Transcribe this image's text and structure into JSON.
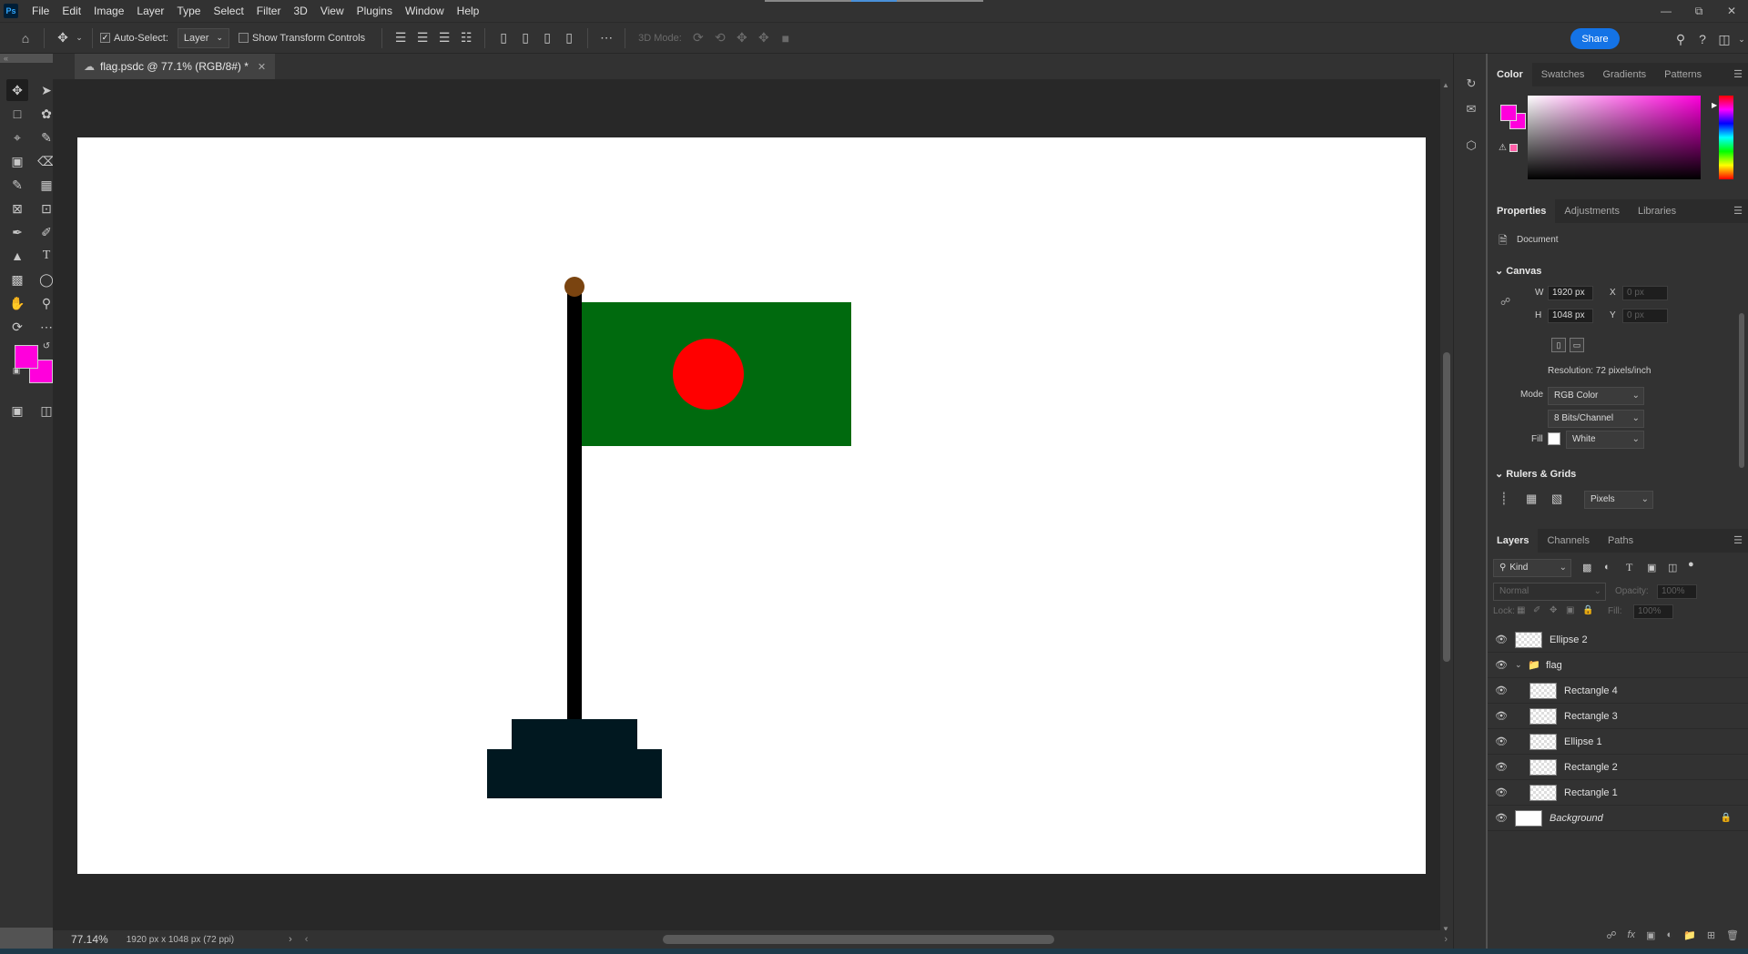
{
  "menubar": {
    "logo": "Ps",
    "items": [
      "File",
      "Edit",
      "Image",
      "Layer",
      "Type",
      "Select",
      "Filter",
      "3D",
      "View",
      "Plugins",
      "Window",
      "Help"
    ]
  },
  "options": {
    "auto_select_label": "Auto-Select:",
    "auto_select_checked": true,
    "target_value": "Layer",
    "show_transform_label": "Show Transform Controls",
    "mode_3d_label": "3D Mode:",
    "share_label": "Share"
  },
  "document": {
    "tab_title": "flag.psdc @ 77.1% (RGB/8#) *",
    "zoom": "77.14%",
    "info": "1920 px x 1048 px (72 ppi)"
  },
  "colors": {
    "foreground": "#ff00dc",
    "background": "#ff00dc",
    "flag_green": "#006a0e",
    "flag_red": "#ff0000",
    "pole": "#000000",
    "finial": "#7a4410",
    "base": "#011820"
  },
  "color_panel": {
    "tabs": [
      "Color",
      "Swatches",
      "Gradients",
      "Patterns"
    ]
  },
  "properties_panel": {
    "tabs": [
      "Properties",
      "Adjustments",
      "Libraries"
    ],
    "document_label": "Document",
    "canvas_header": "Canvas",
    "w_label": "W",
    "w_value": "1920 px",
    "h_label": "H",
    "h_value": "1048 px",
    "x_label": "X",
    "x_placeholder": "0 px",
    "y_label": "Y",
    "y_placeholder": "0 px",
    "resolution": "Resolution: 72 pixels/inch",
    "mode_label": "Mode",
    "mode_value": "RGB Color",
    "bits_value": "8 Bits/Channel",
    "fill_label": "Fill",
    "fill_value": "White",
    "rulers_header": "Rulers & Grids",
    "units_value": "Pixels"
  },
  "layers_panel": {
    "tabs": [
      "Layers",
      "Channels",
      "Paths"
    ],
    "kind_label": "Kind",
    "blend_mode": "Normal",
    "opacity_label": "Opacity:",
    "opacity_value": "100%",
    "lock_label": "Lock:",
    "fill_label": "Fill:",
    "fill_value": "100%",
    "layers": [
      {
        "name": "Ellipse 2",
        "indent": false
      },
      {
        "name": "flag",
        "indent": false,
        "group": true
      },
      {
        "name": "Rectangle 4",
        "indent": true
      },
      {
        "name": "Rectangle 3",
        "indent": true
      },
      {
        "name": "Ellipse 1",
        "indent": true
      },
      {
        "name": "Rectangle 2",
        "indent": true
      },
      {
        "name": "Rectangle 1",
        "indent": true
      },
      {
        "name": "Background",
        "indent": false,
        "background": true
      }
    ]
  }
}
